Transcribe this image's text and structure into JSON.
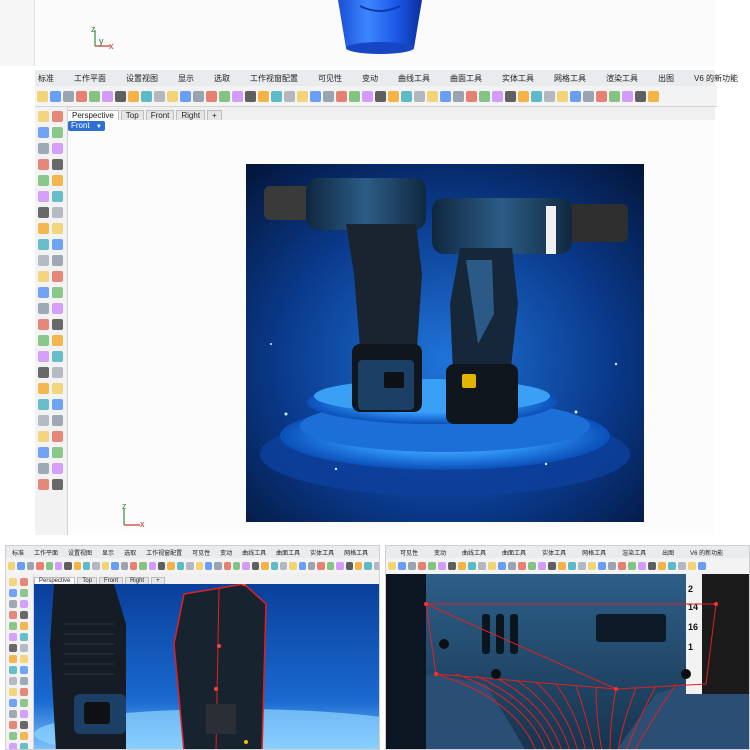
{
  "top_panel": {
    "axis": {
      "y": "y",
      "x": "x",
      "z": "z"
    }
  },
  "main": {
    "menu": [
      "标准",
      "工作平面",
      "设置视图",
      "显示",
      "选取",
      "工作视窗配置",
      "可见性",
      "变动",
      "曲线工具",
      "曲面工具",
      "实体工具",
      "网格工具",
      "渲染工具",
      "出图",
      "V6 的新功能"
    ],
    "tabs": [
      "Perspective",
      "Top",
      "Front",
      "Right"
    ],
    "add_tab": "+",
    "viewport_label": "Front",
    "viewport_dropdown": "▼",
    "axis": {
      "z": "z",
      "x": "x"
    },
    "colors": {
      "accent": "#2f6fd1",
      "menu_bg": "#e9ebee"
    }
  },
  "bottom_left": {
    "menu": [
      "标准",
      "工作平面",
      "设置视图",
      "显示",
      "选取",
      "工作视窗配置",
      "可见性",
      "变动",
      "曲线工具",
      "曲面工具",
      "实体工具",
      "网格工具"
    ],
    "tabs": [
      "Perspective",
      "Top",
      "Front",
      "Right"
    ],
    "add_tab": "+",
    "viewport_label": "Front"
  },
  "bottom_right": {
    "menu": [
      "可见性",
      "变动",
      "曲线工具",
      "曲面工具",
      "实体工具",
      "网格工具",
      "渲染工具",
      "出图",
      "V6 的新功能"
    ]
  }
}
